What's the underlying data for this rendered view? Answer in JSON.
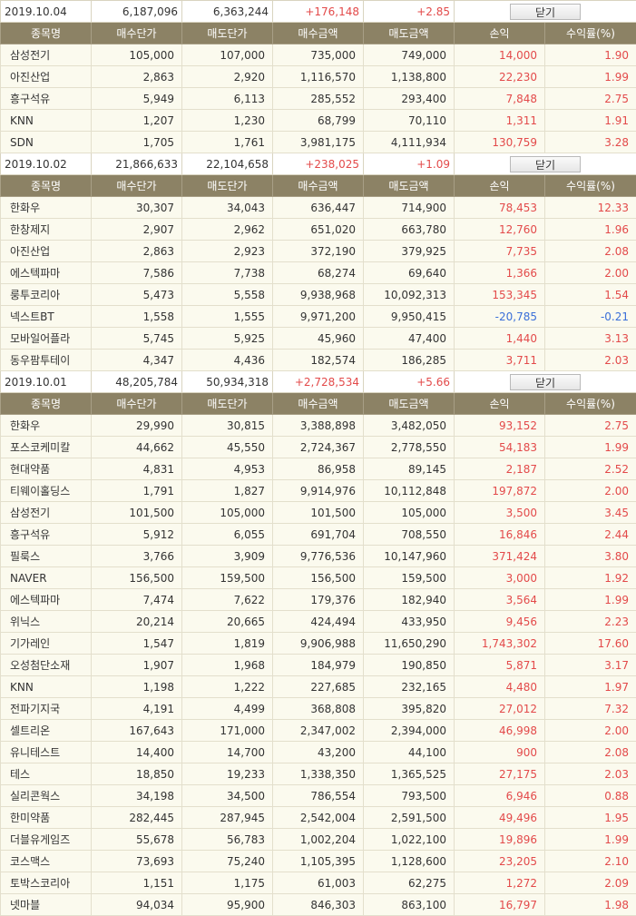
{
  "close_label": "닫기",
  "headers": [
    "종목명",
    "매수단가",
    "매도단가",
    "매수금액",
    "매도금액",
    "손익",
    "수익률(%)"
  ],
  "colors": {
    "header_bg": "#8c8265",
    "row_bg": "#fbfaee",
    "profit": "#e34a4a",
    "loss": "#3a6fd8"
  },
  "groups": [
    {
      "summary": {
        "date": "2019.10.04",
        "buy_total": "6,187,096",
        "sell_total": "6,363,244",
        "profit": "+176,148",
        "rate": "+2.85"
      },
      "rows": [
        {
          "name": "삼성전기",
          "buy_price": "105,000",
          "sell_price": "107,000",
          "buy_amount": "735,000",
          "sell_amount": "749,000",
          "profit": "14,000",
          "rate": "1.90"
        },
        {
          "name": "아진산업",
          "buy_price": "2,863",
          "sell_price": "2,920",
          "buy_amount": "1,116,570",
          "sell_amount": "1,138,800",
          "profit": "22,230",
          "rate": "1.99"
        },
        {
          "name": "흥구석유",
          "buy_price": "5,949",
          "sell_price": "6,113",
          "buy_amount": "285,552",
          "sell_amount": "293,400",
          "profit": "7,848",
          "rate": "2.75"
        },
        {
          "name": "KNN",
          "buy_price": "1,207",
          "sell_price": "1,230",
          "buy_amount": "68,799",
          "sell_amount": "70,110",
          "profit": "1,311",
          "rate": "1.91"
        },
        {
          "name": "SDN",
          "buy_price": "1,705",
          "sell_price": "1,761",
          "buy_amount": "3,981,175",
          "sell_amount": "4,111,934",
          "profit": "130,759",
          "rate": "3.28"
        }
      ]
    },
    {
      "summary": {
        "date": "2019.10.02",
        "buy_total": "21,866,633",
        "sell_total": "22,104,658",
        "profit": "+238,025",
        "rate": "+1.09"
      },
      "rows": [
        {
          "name": "한화우",
          "buy_price": "30,307",
          "sell_price": "34,043",
          "buy_amount": "636,447",
          "sell_amount": "714,900",
          "profit": "78,453",
          "rate": "12.33"
        },
        {
          "name": "한창제지",
          "buy_price": "2,907",
          "sell_price": "2,962",
          "buy_amount": "651,020",
          "sell_amount": "663,780",
          "profit": "12,760",
          "rate": "1.96"
        },
        {
          "name": "아진산업",
          "buy_price": "2,863",
          "sell_price": "2,923",
          "buy_amount": "372,190",
          "sell_amount": "379,925",
          "profit": "7,735",
          "rate": "2.08"
        },
        {
          "name": "에스텍파마",
          "buy_price": "7,586",
          "sell_price": "7,738",
          "buy_amount": "68,274",
          "sell_amount": "69,640",
          "profit": "1,366",
          "rate": "2.00"
        },
        {
          "name": "룽투코리아",
          "buy_price": "5,473",
          "sell_price": "5,558",
          "buy_amount": "9,938,968",
          "sell_amount": "10,092,313",
          "profit": "153,345",
          "rate": "1.54"
        },
        {
          "name": "넥스트BT",
          "buy_price": "1,558",
          "sell_price": "1,555",
          "buy_amount": "9,971,200",
          "sell_amount": "9,950,415",
          "profit": "-20,785",
          "rate": "-0.21"
        },
        {
          "name": "모바일어플라",
          "buy_price": "5,745",
          "sell_price": "5,925",
          "buy_amount": "45,960",
          "sell_amount": "47,400",
          "profit": "1,440",
          "rate": "3.13"
        },
        {
          "name": "동우팜투테이",
          "buy_price": "4,347",
          "sell_price": "4,436",
          "buy_amount": "182,574",
          "sell_amount": "186,285",
          "profit": "3,711",
          "rate": "2.03"
        }
      ]
    },
    {
      "summary": {
        "date": "2019.10.01",
        "buy_total": "48,205,784",
        "sell_total": "50,934,318",
        "profit": "+2,728,534",
        "rate": "+5.66"
      },
      "rows": [
        {
          "name": "한화우",
          "buy_price": "29,990",
          "sell_price": "30,815",
          "buy_amount": "3,388,898",
          "sell_amount": "3,482,050",
          "profit": "93,152",
          "rate": "2.75"
        },
        {
          "name": "포스코케미칼",
          "buy_price": "44,662",
          "sell_price": "45,550",
          "buy_amount": "2,724,367",
          "sell_amount": "2,778,550",
          "profit": "54,183",
          "rate": "1.99"
        },
        {
          "name": "현대약품",
          "buy_price": "4,831",
          "sell_price": "4,953",
          "buy_amount": "86,958",
          "sell_amount": "89,145",
          "profit": "2,187",
          "rate": "2.52"
        },
        {
          "name": "티웨이홀딩스",
          "buy_price": "1,791",
          "sell_price": "1,827",
          "buy_amount": "9,914,976",
          "sell_amount": "10,112,848",
          "profit": "197,872",
          "rate": "2.00"
        },
        {
          "name": "삼성전기",
          "buy_price": "101,500",
          "sell_price": "105,000",
          "buy_amount": "101,500",
          "sell_amount": "105,000",
          "profit": "3,500",
          "rate": "3.45"
        },
        {
          "name": "흥구석유",
          "buy_price": "5,912",
          "sell_price": "6,055",
          "buy_amount": "691,704",
          "sell_amount": "708,550",
          "profit": "16,846",
          "rate": "2.44"
        },
        {
          "name": "필룩스",
          "buy_price": "3,766",
          "sell_price": "3,909",
          "buy_amount": "9,776,536",
          "sell_amount": "10,147,960",
          "profit": "371,424",
          "rate": "3.80"
        },
        {
          "name": "NAVER",
          "buy_price": "156,500",
          "sell_price": "159,500",
          "buy_amount": "156,500",
          "sell_amount": "159,500",
          "profit": "3,000",
          "rate": "1.92"
        },
        {
          "name": "에스텍파마",
          "buy_price": "7,474",
          "sell_price": "7,622",
          "buy_amount": "179,376",
          "sell_amount": "182,940",
          "profit": "3,564",
          "rate": "1.99"
        },
        {
          "name": "위닉스",
          "buy_price": "20,214",
          "sell_price": "20,665",
          "buy_amount": "424,494",
          "sell_amount": "433,950",
          "profit": "9,456",
          "rate": "2.23"
        },
        {
          "name": "기가레인",
          "buy_price": "1,547",
          "sell_price": "1,819",
          "buy_amount": "9,906,988",
          "sell_amount": "11,650,290",
          "profit": "1,743,302",
          "rate": "17.60"
        },
        {
          "name": "오성첨단소재",
          "buy_price": "1,907",
          "sell_price": "1,968",
          "buy_amount": "184,979",
          "sell_amount": "190,850",
          "profit": "5,871",
          "rate": "3.17"
        },
        {
          "name": "KNN",
          "buy_price": "1,198",
          "sell_price": "1,222",
          "buy_amount": "227,685",
          "sell_amount": "232,165",
          "profit": "4,480",
          "rate": "1.97"
        },
        {
          "name": "전파기지국",
          "buy_price": "4,191",
          "sell_price": "4,499",
          "buy_amount": "368,808",
          "sell_amount": "395,820",
          "profit": "27,012",
          "rate": "7.32"
        },
        {
          "name": "셀트리온",
          "buy_price": "167,643",
          "sell_price": "171,000",
          "buy_amount": "2,347,002",
          "sell_amount": "2,394,000",
          "profit": "46,998",
          "rate": "2.00"
        },
        {
          "name": "유니테스트",
          "buy_price": "14,400",
          "sell_price": "14,700",
          "buy_amount": "43,200",
          "sell_amount": "44,100",
          "profit": "900",
          "rate": "2.08"
        },
        {
          "name": "테스",
          "buy_price": "18,850",
          "sell_price": "19,233",
          "buy_amount": "1,338,350",
          "sell_amount": "1,365,525",
          "profit": "27,175",
          "rate": "2.03"
        },
        {
          "name": "실리콘웍스",
          "buy_price": "34,198",
          "sell_price": "34,500",
          "buy_amount": "786,554",
          "sell_amount": "793,500",
          "profit": "6,946",
          "rate": "0.88"
        },
        {
          "name": "한미약품",
          "buy_price": "282,445",
          "sell_price": "287,945",
          "buy_amount": "2,542,004",
          "sell_amount": "2,591,500",
          "profit": "49,496",
          "rate": "1.95"
        },
        {
          "name": "더블유게임즈",
          "buy_price": "55,678",
          "sell_price": "56,783",
          "buy_amount": "1,002,204",
          "sell_amount": "1,022,100",
          "profit": "19,896",
          "rate": "1.99"
        },
        {
          "name": "코스맥스",
          "buy_price": "73,693",
          "sell_price": "75,240",
          "buy_amount": "1,105,395",
          "sell_amount": "1,128,600",
          "profit": "23,205",
          "rate": "2.10"
        },
        {
          "name": "토박스코리아",
          "buy_price": "1,151",
          "sell_price": "1,175",
          "buy_amount": "61,003",
          "sell_amount": "62,275",
          "profit": "1,272",
          "rate": "2.09"
        },
        {
          "name": "넷마블",
          "buy_price": "94,034",
          "sell_price": "95,900",
          "buy_amount": "846,303",
          "sell_amount": "863,100",
          "profit": "16,797",
          "rate": "1.98"
        }
      ]
    }
  ]
}
